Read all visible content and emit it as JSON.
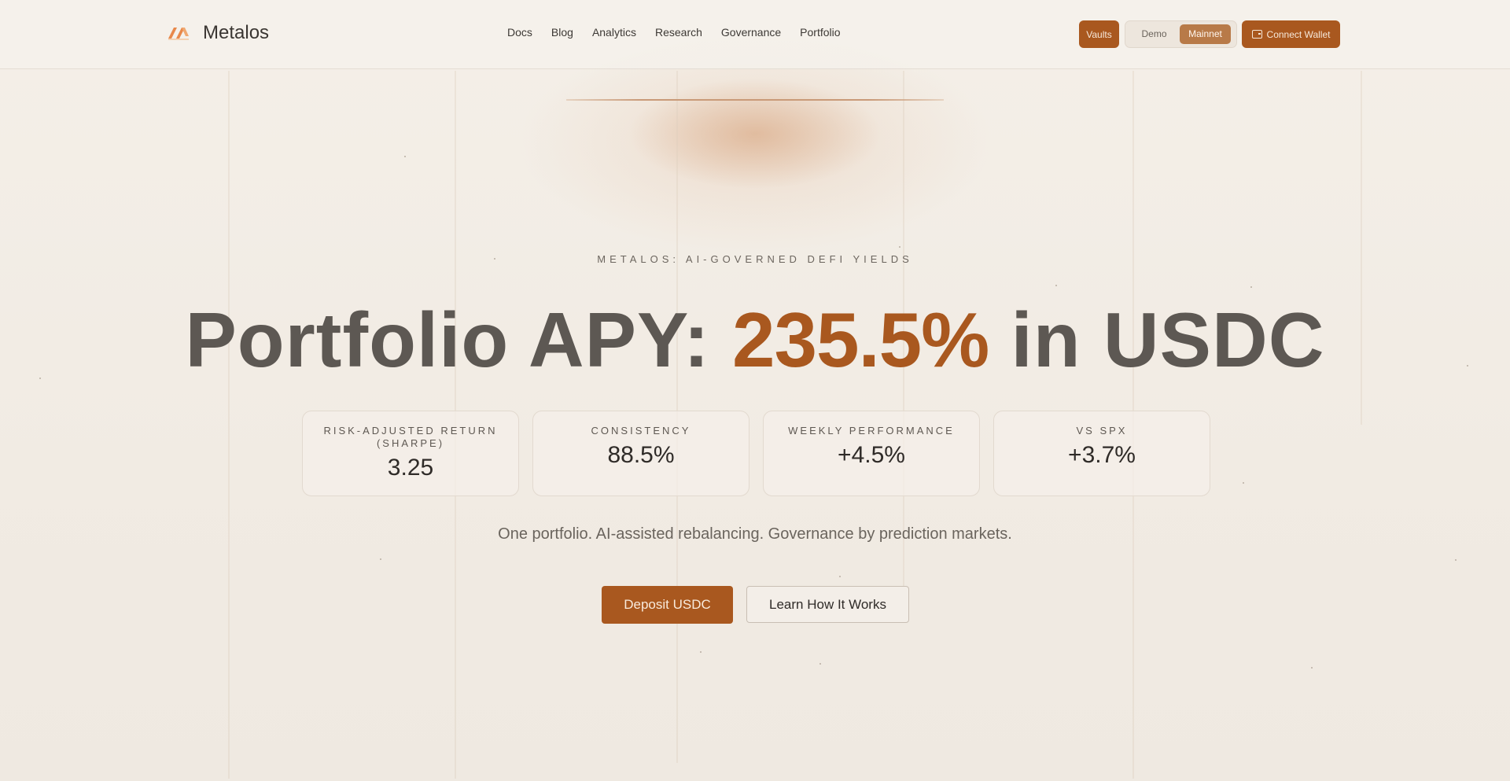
{
  "brand": {
    "name": "Metalos"
  },
  "nav": [
    "Docs",
    "Blog",
    "Analytics",
    "Research",
    "Governance",
    "Portfolio"
  ],
  "header_actions": {
    "vaults": "Vaults",
    "network": {
      "options": [
        "Demo",
        "Mainnet"
      ],
      "selected": "Mainnet"
    },
    "connect_wallet": "Connect Wallet"
  },
  "hero": {
    "eyebrow": "METALOS: AI-GOVERNED DEFI YIELDS",
    "headline_prefix": "Portfolio APY: ",
    "headline_apy": "235.5%",
    "headline_suffix": " in USDC",
    "tagline": "One portfolio. AI-assisted rebalancing. Governance by prediction markets."
  },
  "stats": [
    {
      "label": "RISK-ADJUSTED RETURN (SHARPE)",
      "value": "3.25"
    },
    {
      "label": "CONSISTENCY",
      "value": "88.5%"
    },
    {
      "label": "WEEKLY PERFORMANCE",
      "value": "+4.5%"
    },
    {
      "label": "VS SPX",
      "value": "+3.7%"
    }
  ],
  "cta": {
    "primary": "Deposit USDC",
    "secondary": "Learn How It Works"
  },
  "colors": {
    "accent": "#a9581f",
    "background": "#f2ede6",
    "text": "#5d5853"
  }
}
